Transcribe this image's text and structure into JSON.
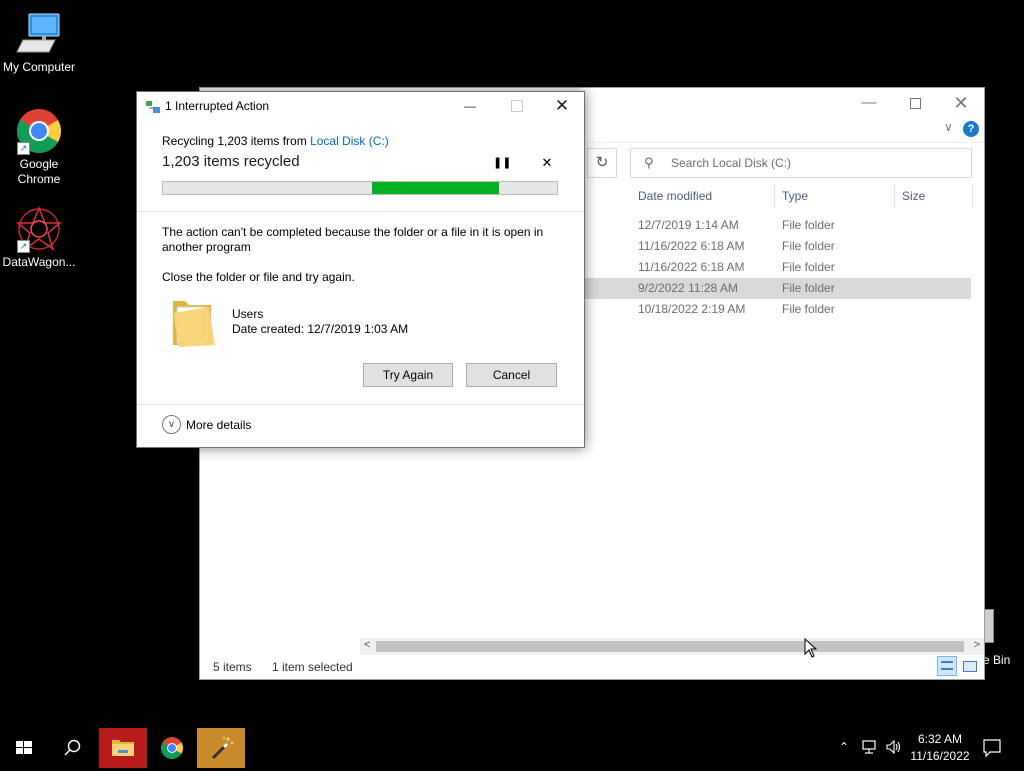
{
  "desktop": {
    "icons": [
      {
        "label": "My Computer"
      },
      {
        "label": "Google Chrome"
      },
      {
        "label": "DataWagon..."
      }
    ],
    "recycle_bin_label_partial": "e Bin"
  },
  "explorer": {
    "search_placeholder": "Search Local Disk (C:)",
    "columns": {
      "date": "Date modified",
      "type": "Type",
      "size": "Size"
    },
    "rows": [
      {
        "date": "12/7/2019 1:14 AM",
        "type": "File folder"
      },
      {
        "date": "11/16/2022 6:18 AM",
        "type": "File folder"
      },
      {
        "date": "11/16/2022 6:18 AM",
        "type": "File folder"
      },
      {
        "date": "9/2/2022 11:28 AM",
        "type": "File folder"
      },
      {
        "date": "10/18/2022 2:19 AM",
        "type": "File folder"
      }
    ],
    "status": {
      "items": "5 items",
      "selected": "1 item selected"
    }
  },
  "dialog": {
    "title": "1 Interrupted Action",
    "recycling_prefix": "Recycling 1,203 items from ",
    "recycling_link": "Local Disk (C:)",
    "progress_text": "1,203 items recycled",
    "message": "The action can't be completed because the folder or a file in it is open in another program",
    "instruction": "Close the folder or file and try again.",
    "file_name": "Users",
    "file_date": "Date created: 12/7/2019 1:03 AM",
    "try_again_label": "Try Again",
    "cancel_label": "Cancel",
    "more_details_label": "More details",
    "progress_segment": {
      "start_fraction": 0.53,
      "end_fraction": 0.853
    },
    "progress_color": "#06b025"
  },
  "taskbar": {
    "time": "6:32 AM",
    "date": "11/16/2022"
  },
  "colors": {
    "accent": "#0078d7",
    "link": "#0066cc",
    "selected_row": "#d9d9d9"
  }
}
